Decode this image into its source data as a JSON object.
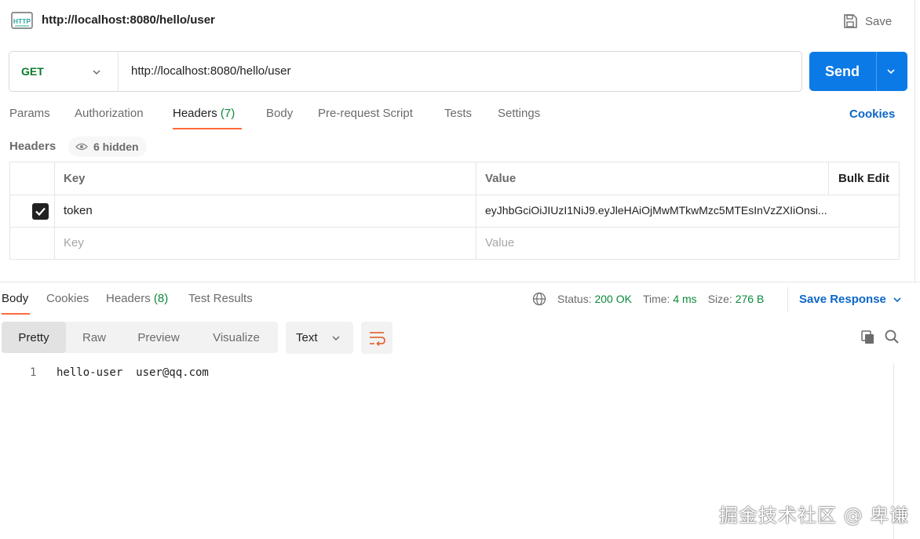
{
  "header": {
    "title_url": "http://localhost:8080/hello/user",
    "save_label": "Save"
  },
  "request": {
    "method": "GET",
    "url": "http://localhost:8080/hello/user",
    "send_label": "Send"
  },
  "request_tabs": {
    "params": "Params",
    "authorization": "Authorization",
    "headers": "Headers",
    "headers_count": "(7)",
    "body": "Body",
    "pre_request": "Pre-request Script",
    "tests": "Tests",
    "settings": "Settings",
    "cookies": "Cookies"
  },
  "headers_section": {
    "label": "Headers",
    "hidden": "6 hidden",
    "columns": {
      "key": "Key",
      "value": "Value",
      "bulk_edit": "Bulk Edit"
    },
    "rows": [
      {
        "checked": true,
        "key": "token",
        "value": "eyJhbGciOiJIUzI1NiJ9.eyJleHAiOjMwMTkwMzc5MTEsInVzZXIiOnsi..."
      }
    ],
    "placeholder_key": "Key",
    "placeholder_value": "Value"
  },
  "response_tabs": {
    "body": "Body",
    "cookies": "Cookies",
    "headers": "Headers",
    "headers_count": "(8)",
    "test_results": "Test Results"
  },
  "response_status": {
    "status_label": "Status:",
    "status_value": "200 OK",
    "time_label": "Time:",
    "time_value": "4 ms",
    "size_label": "Size:",
    "size_value": "276 B",
    "save_response": "Save Response"
  },
  "view_modes": {
    "pretty": "Pretty",
    "raw": "Raw",
    "preview": "Preview",
    "visualize": "Visualize",
    "format": "Text"
  },
  "response_body": {
    "line_number": "1",
    "line_text": "hello-user  user@qq.com"
  },
  "watermark": "掘金技术社区 @ 卑谦",
  "colors": {
    "send_blue": "#0c7ae6",
    "accent_orange": "#ff6c37",
    "get_green": "#0b7a2a",
    "link_blue": "#0c66c8"
  }
}
